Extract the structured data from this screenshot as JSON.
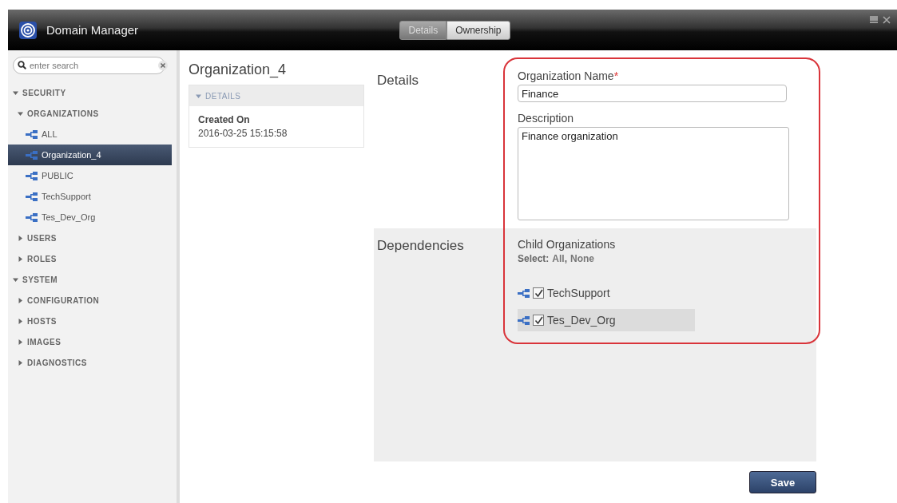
{
  "window": {
    "title": "Domain Manager"
  },
  "tabs": [
    {
      "label": "Details",
      "selected": true
    },
    {
      "label": "Ownership",
      "selected": false
    }
  ],
  "sidebar": {
    "search": {
      "placeholder": "enter search"
    },
    "tree": [
      {
        "label": "SECURITY",
        "expanded": true,
        "children": [
          {
            "label": "ORGANIZATIONS",
            "expanded": true,
            "children": [
              {
                "label": "ALL",
                "selected": false
              },
              {
                "label": "Organization_4",
                "selected": true
              },
              {
                "label": "PUBLIC",
                "selected": false
              },
              {
                "label": "TechSupport",
                "selected": false
              },
              {
                "label": "Tes_Dev_Org",
                "selected": false
              }
            ]
          },
          {
            "label": "USERS",
            "expanded": false
          },
          {
            "label": "ROLES",
            "expanded": false
          }
        ]
      },
      {
        "label": "SYSTEM",
        "expanded": true,
        "children": [
          {
            "label": "CONFIGURATION",
            "expanded": false
          },
          {
            "label": "HOSTS",
            "expanded": false
          },
          {
            "label": "IMAGES",
            "expanded": false
          },
          {
            "label": "DIAGNOSTICS",
            "expanded": false
          }
        ]
      }
    ]
  },
  "summary": {
    "title": "Organization_4",
    "section": {
      "label": "DETAILS",
      "expanded": true
    },
    "field_label": "Created On",
    "field_value": "2016-03-25 15:15:58"
  },
  "details": {
    "heading": "Details",
    "name_label": "Organization Name",
    "required_mark": "*",
    "name_value": "Finance",
    "description_label": "Description",
    "description_value": "Finance organization"
  },
  "dependencies": {
    "heading": "Dependencies",
    "label": "Child Organizations",
    "select_prefix": "Select:",
    "select_all": "All",
    "separator": ",",
    "select_none": "None",
    "children": [
      {
        "label": "TechSupport",
        "checked": true,
        "highlighted": false
      },
      {
        "label": "Tes_Dev_Org",
        "checked": true,
        "highlighted": true
      }
    ]
  },
  "save_button": "Save"
}
